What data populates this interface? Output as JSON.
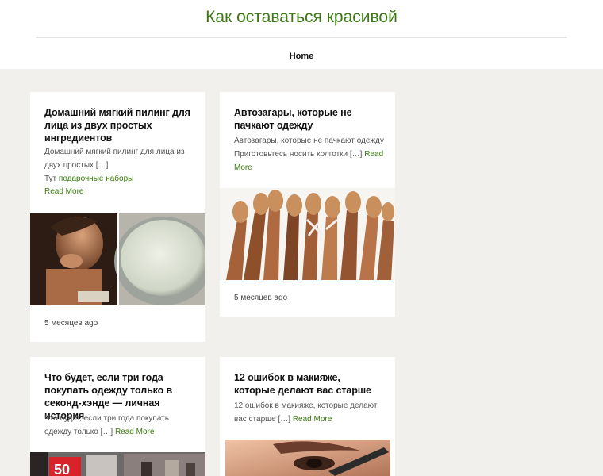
{
  "site": {
    "title": "Как оставаться красивой"
  },
  "nav": {
    "items": [
      {
        "label": "Home"
      }
    ]
  },
  "posts": [
    {
      "title": "Домашний мягкий пилинг для лица из двух простых ингредиентов",
      "excerpt": "Домашний мягкий пилинг для лица из двух простых […]",
      "extra_prefix": "Тут ",
      "extra_link": "подарочные наборы",
      "read_more": "Read More",
      "date": "5 месяцев ago"
    },
    {
      "title": "Автозагары, которые не пачкают одежду",
      "excerpt": "Автозагары, которые не пачкают одежду Приготовьтесь носить колготки […] ",
      "read_more": "Read More",
      "date": "5 месяцев ago"
    },
    {
      "title": "Что будет, если три года покупать одежду только в секонд-хэнде — личная история",
      "excerpt": "Что будет, если три года покупать одежду только […] ",
      "read_more": "Read More",
      "sign_text": "50"
    },
    {
      "title": "12 ошибок в макияже, которые делают вас старше",
      "excerpt": "12 ошибок в макияже, которые делают вас старше […] ",
      "read_more": "Read More"
    }
  ],
  "colors": {
    "accent": "#3b7a12",
    "background": "#f1f0ec",
    "card": "#ffffff"
  }
}
